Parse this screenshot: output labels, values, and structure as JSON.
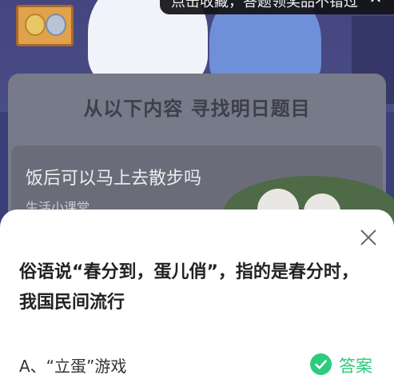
{
  "toast": {
    "message": "点击收藏，答题领奖品不错过",
    "close_icon": "close-icon"
  },
  "background_card": {
    "title": "从以下内容  寻找明日题目",
    "question_title": "饭后可以马上去散步吗",
    "question_category": "生活小课堂"
  },
  "sheet": {
    "question": "俗语说“春分到，蛋儿俏”，指的是春分时，我国民间流行",
    "option_a": "A、“立蛋”游戏",
    "answer_label": "答案",
    "answer_icon": "check-circle-icon",
    "close_icon": "close-icon",
    "accent_color": "#2ecb7e"
  }
}
